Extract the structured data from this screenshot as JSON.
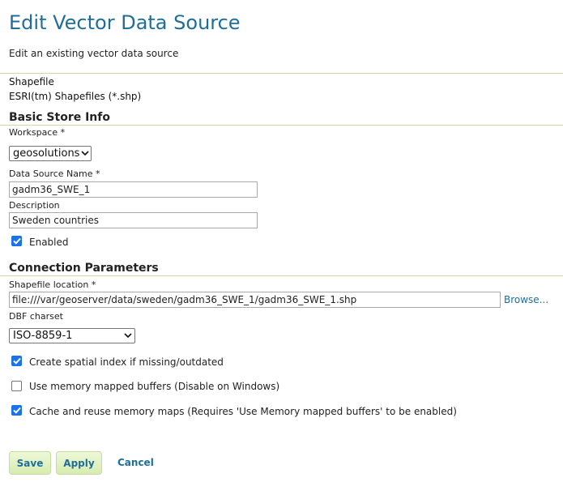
{
  "page": {
    "title": "Edit Vector Data Source",
    "subtitle": "Edit an existing vector data source"
  },
  "store_type": {
    "name": "Shapefile",
    "description": "ESRI(tm) Shapefiles (*.shp)"
  },
  "basic_info": {
    "heading": "Basic Store Info",
    "workspace_label": "Workspace *",
    "workspace_value": "geosolutions",
    "name_label": "Data Source Name *",
    "name_value": "gadm36_SWE_1",
    "description_label": "Description",
    "description_value": "Sweden countries",
    "enabled_label": "Enabled",
    "enabled_checked": true
  },
  "connection": {
    "heading": "Connection Parameters",
    "location_label": "Shapefile location *",
    "location_value": "file:///var/geoserver/data/sweden/gadm36_SWE_1/gadm36_SWE_1.shp",
    "browse_label": "Browse...",
    "charset_label": "DBF charset",
    "charset_value": "ISO-8859-1",
    "options": [
      {
        "label": "Create spatial index if missing/outdated",
        "checked": true
      },
      {
        "label": "Use memory mapped buffers (Disable on Windows)",
        "checked": false
      },
      {
        "label": "Cache and reuse memory maps (Requires 'Use Memory mapped buffers' to be enabled)",
        "checked": true
      }
    ]
  },
  "actions": {
    "save": "Save",
    "apply": "Apply",
    "cancel": "Cancel"
  }
}
